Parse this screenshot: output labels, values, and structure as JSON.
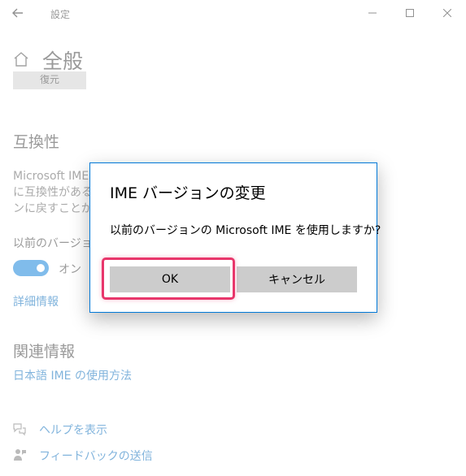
{
  "window": {
    "title": "設定",
    "controls": {
      "minimize": "minimize-icon",
      "maximize": "maximize-icon",
      "close": "close-icon"
    }
  },
  "header": {
    "title": "全般",
    "home_icon": "home-icon",
    "back_icon": "back-arrow-icon"
  },
  "clipped_button_label": "復元",
  "compatibility": {
    "heading": "互換性",
    "desc_lines": [
      "Microsoft IME",
      "に互換性がある",
      "ンに戻すことがで"
    ],
    "toggle_label": "以前のバージョ",
    "toggle_state": "オン",
    "details_link": "詳細情報"
  },
  "related": {
    "heading": "関連情報",
    "link": "日本語 IME の使用方法"
  },
  "footer": {
    "help": "ヘルプを表示",
    "feedback": "フィードバックの送信"
  },
  "dialog": {
    "title": "IME バージョンの変更",
    "message": "以前のバージョンの Microsoft IME を使用しますか?",
    "ok_label": "OK",
    "cancel_label": "キャンセル"
  },
  "colors": {
    "accent": "#0078d7",
    "link": "#0067b8",
    "highlight": "#e8366b"
  }
}
